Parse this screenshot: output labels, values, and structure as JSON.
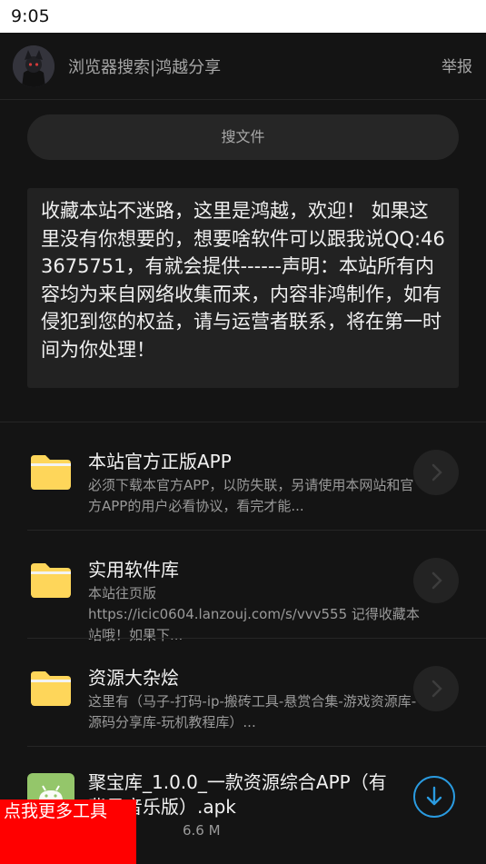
{
  "status_bar": {
    "time": "9:05"
  },
  "header": {
    "title": "浏览器搜索|鸿越分享",
    "report_label": "举报"
  },
  "search": {
    "label": "搜文件"
  },
  "notice": {
    "text": "收藏本站不迷路，这里是鸿越，欢迎！ 如果这里没有你想要的，想要啥软件可以跟我说QQ:463675751，有就会提供------声明：本站所有内容均为来自网络收集而来，内容非鸿制作，如有侵犯到您的权益，请与运营者联系，将在第一时间为你处理！"
  },
  "folders": [
    {
      "title": "本站官方正版APP",
      "desc": "必须下载本官方APP，以防失联，另请使用本网站和官方APP的用户必看协议，看完才能..."
    },
    {
      "title": "实用软件库",
      "desc_line1": "本站往页版",
      "desc": "https://icic0604.lanzouj.com/s/vvv555 记得收藏本站哦！如果下..."
    },
    {
      "title": "资源大杂烩",
      "desc": "这里有（马子-打码-ip-搬砖工具-悬赏合集-游戏资源库-源码分享库-玩机教程库）..."
    }
  ],
  "file": {
    "title": "聚宝库_1.0.0_一款资源综合APP（有背景音乐版）.apk",
    "size": "6.6 M"
  },
  "promo": {
    "label": "点我更多工具"
  },
  "colors": {
    "background": "#141414",
    "folder_yellow": "#fed65a",
    "android_green": "#94c66a",
    "download_blue": "#2a9be0",
    "promo_red": "#ff0000"
  },
  "icons": {
    "folder": "folder-icon",
    "chevron": "chevron-right-icon",
    "download": "download-icon",
    "apk": "android-apk-icon"
  }
}
